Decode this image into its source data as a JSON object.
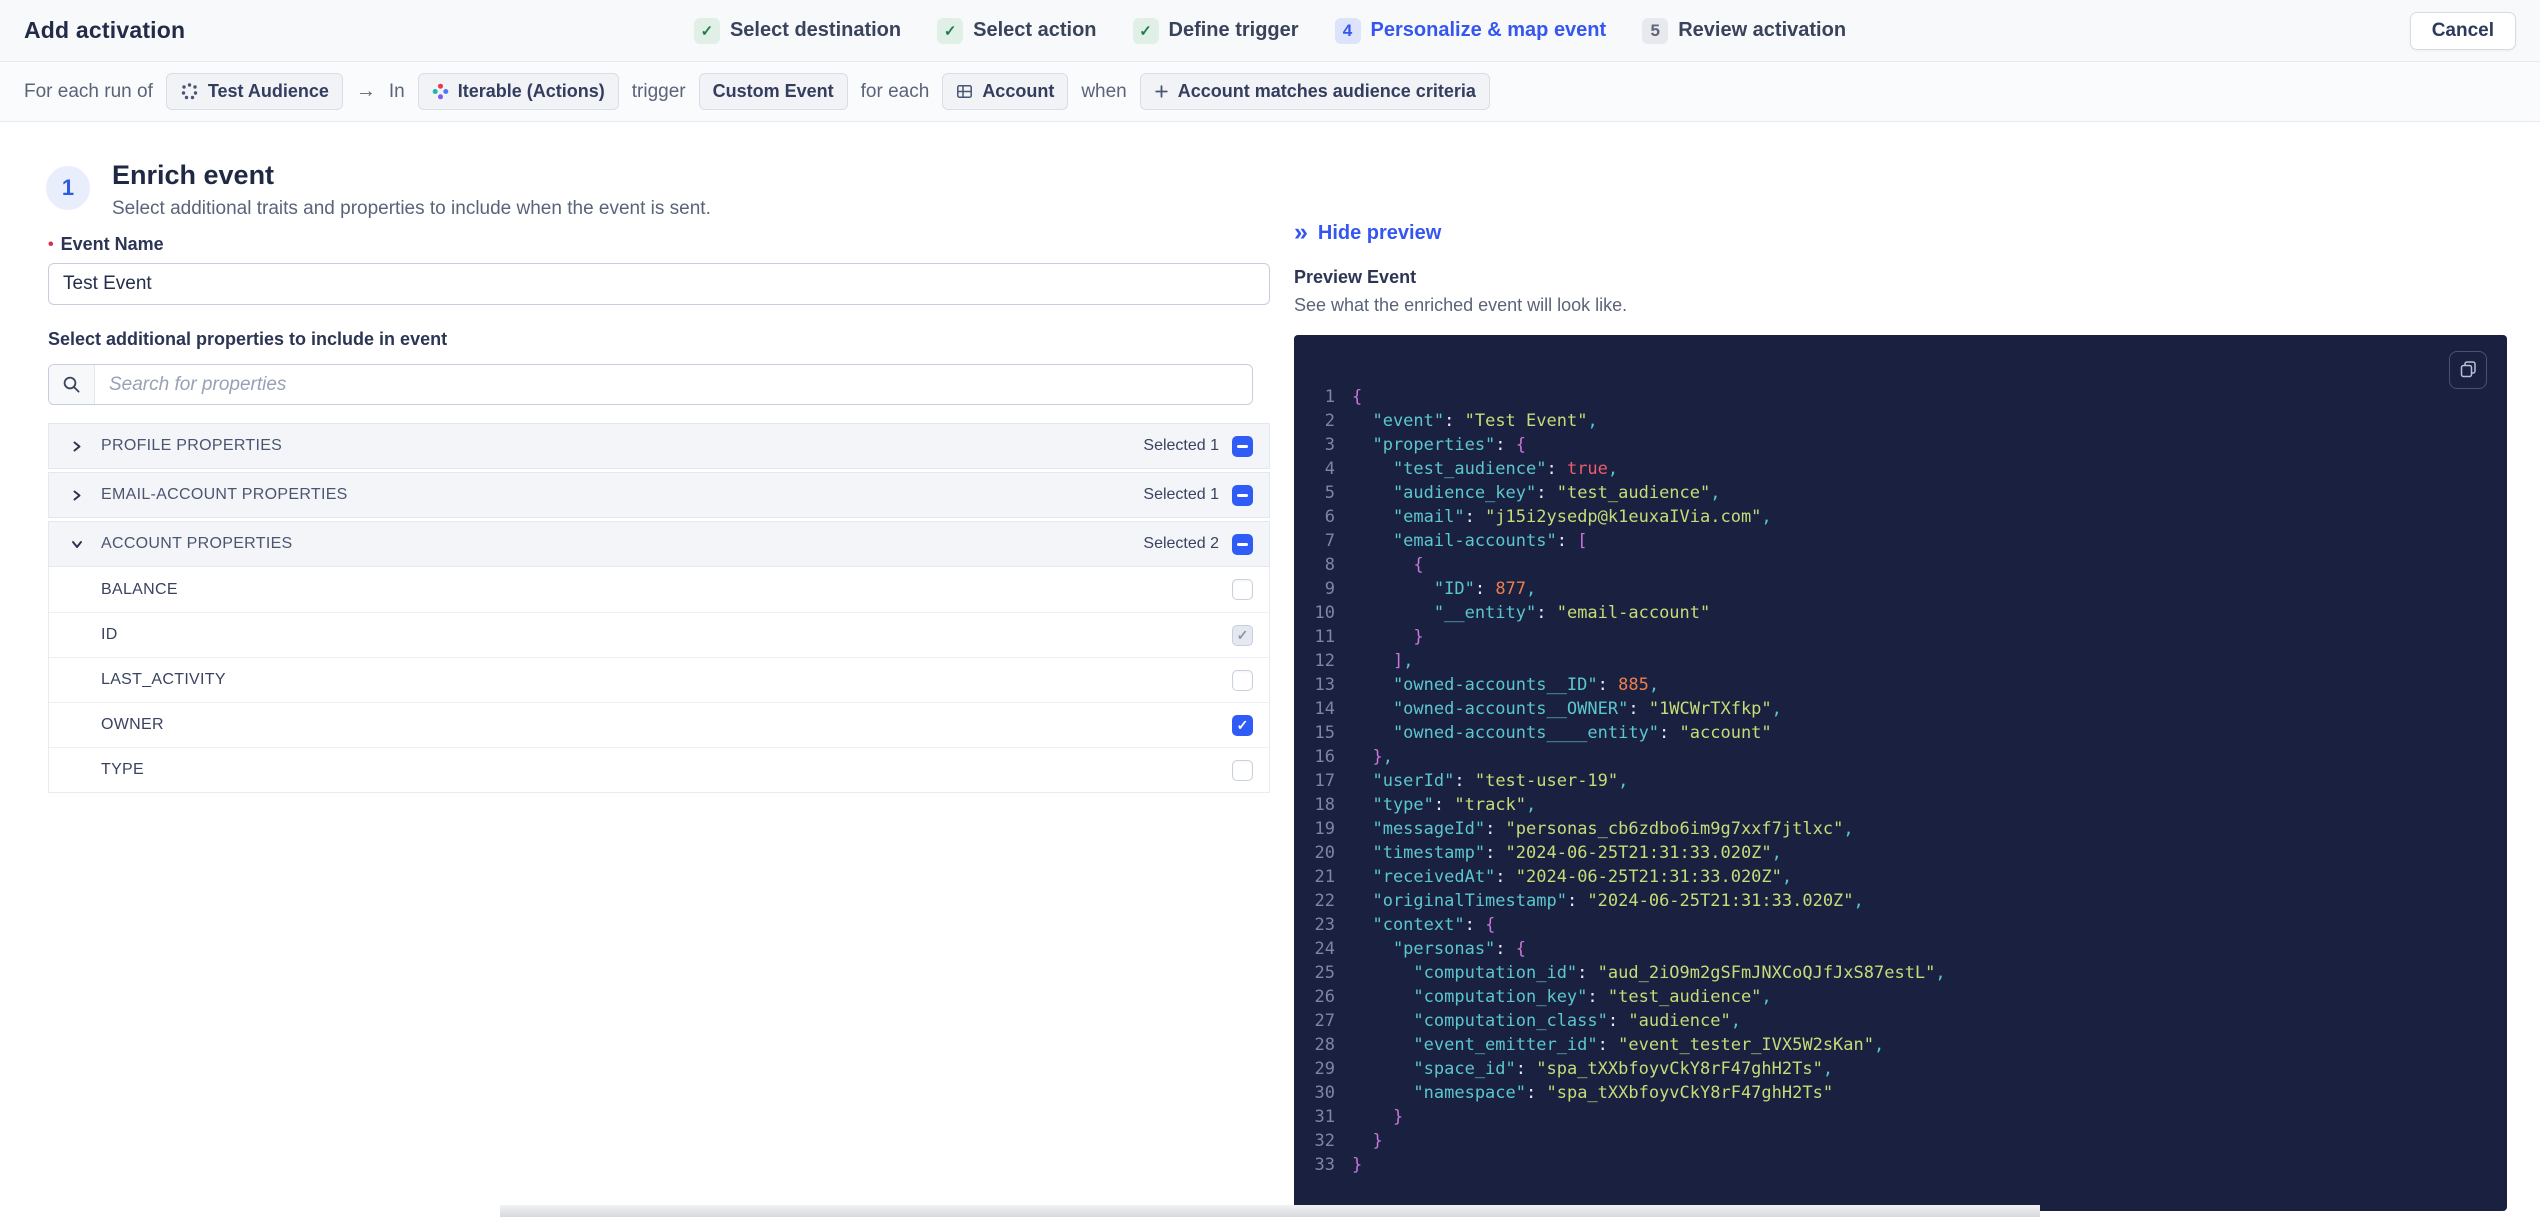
{
  "colors": {
    "accent": "#3556f0",
    "code_background": "#1a2040",
    "code_key": "#5bc7cc",
    "code_string": "#c6dc78",
    "code_number": "#ed7f4e",
    "code_boolean": "#ee5d6c",
    "code_brace": "#c877d8",
    "code_colon": "#e8ebf5",
    "checkbox_blue": "#2f5cf6",
    "step_done_green": "#1e7e47"
  },
  "header": {
    "title": "Add activation",
    "cancel_label": "Cancel",
    "steps": [
      {
        "label": "Select destination",
        "state": "done"
      },
      {
        "label": "Select action",
        "state": "done"
      },
      {
        "label": "Define trigger",
        "state": "done"
      },
      {
        "label": "Personalize & map event",
        "state": "active",
        "number": "4"
      },
      {
        "label": "Review activation",
        "state": "upcoming",
        "number": "5"
      }
    ]
  },
  "breadcrumb": {
    "segments": [
      {
        "type": "text",
        "text": "For each run of"
      },
      {
        "type": "chip",
        "text": "Test Audience",
        "icon": "audience-icon"
      },
      {
        "type": "arrow",
        "text": "→"
      },
      {
        "type": "text",
        "text": "In"
      },
      {
        "type": "chip",
        "text": "Iterable (Actions)",
        "icon": "iterable-icon"
      },
      {
        "type": "text",
        "text": "trigger"
      },
      {
        "type": "chip",
        "text": "Custom Event"
      },
      {
        "type": "text",
        "text": "for each"
      },
      {
        "type": "chip",
        "text": "Account",
        "icon": "grid-icon"
      },
      {
        "type": "text",
        "text": "when"
      },
      {
        "type": "chip",
        "text": "Account matches audience criteria",
        "icon": "plus-icon"
      }
    ]
  },
  "enrich": {
    "step_number": "1",
    "title": "Enrich event",
    "subtitle": "Select additional traits and properties to include when the event is sent.",
    "event_name_label": "Event Name",
    "event_name_value": "Test Event",
    "properties_label": "Select additional properties to include in event",
    "search_placeholder": "Search for properties",
    "groups": [
      {
        "label": "PROFILE PROPERTIES",
        "selected_text": "Selected 1",
        "expanded": false,
        "checkbox": "indeterminate",
        "children": []
      },
      {
        "label": "EMAIL-ACCOUNT PROPERTIES",
        "selected_text": "Selected 1",
        "expanded": false,
        "checkbox": "indeterminate",
        "children": []
      },
      {
        "label": "ACCOUNT PROPERTIES",
        "selected_text": "Selected 2",
        "expanded": true,
        "checkbox": "indeterminate",
        "children": [
          {
            "label": "BALANCE",
            "checkbox": "unchecked"
          },
          {
            "label": "ID",
            "checkbox": "checked-disabled"
          },
          {
            "label": "LAST_ACTIVITY",
            "checkbox": "unchecked"
          },
          {
            "label": "OWNER",
            "checkbox": "checked"
          },
          {
            "label": "TYPE",
            "checkbox": "unchecked"
          }
        ]
      }
    ]
  },
  "preview": {
    "hide_label": "Hide preview",
    "title": "Preview Event",
    "subtitle": "See what the enriched event will look like.",
    "code_lines": [
      [
        [
          "br",
          "{"
        ]
      ],
      [
        [
          "k",
          "  \"event\""
        ],
        [
          "c",
          ": "
        ],
        [
          "s",
          "\"Test Event\""
        ],
        [
          "k",
          ","
        ]
      ],
      [
        [
          "k",
          "  \"properties\""
        ],
        [
          "c",
          ": "
        ],
        [
          "br",
          "{"
        ]
      ],
      [
        [
          "k",
          "    \"test_audience\""
        ],
        [
          "c",
          ": "
        ],
        [
          "b",
          "true"
        ],
        [
          "k",
          ","
        ]
      ],
      [
        [
          "k",
          "    \"audience_key\""
        ],
        [
          "c",
          ": "
        ],
        [
          "s",
          "\"test_audience\""
        ],
        [
          "k",
          ","
        ]
      ],
      [
        [
          "k",
          "    \"email\""
        ],
        [
          "c",
          ": "
        ],
        [
          "s",
          "\"j15i2ysedp@k1euxaIVia.com\""
        ],
        [
          "k",
          ","
        ]
      ],
      [
        [
          "k",
          "    \"email-accounts\""
        ],
        [
          "c",
          ": "
        ],
        [
          "br",
          "["
        ]
      ],
      [
        [
          "br",
          "      {"
        ]
      ],
      [
        [
          "k",
          "        \"ID\""
        ],
        [
          "c",
          ": "
        ],
        [
          "n",
          "877"
        ],
        [
          "k",
          ","
        ]
      ],
      [
        [
          "k",
          "        \"__entity\""
        ],
        [
          "c",
          ": "
        ],
        [
          "s",
          "\"email-account\""
        ]
      ],
      [
        [
          "br",
          "      }"
        ]
      ],
      [
        [
          "br",
          "    ]"
        ],
        [
          "k",
          ","
        ]
      ],
      [
        [
          "k",
          "    \"owned-accounts__ID\""
        ],
        [
          "c",
          ": "
        ],
        [
          "n",
          "885"
        ],
        [
          "k",
          ","
        ]
      ],
      [
        [
          "k",
          "    \"owned-accounts__OWNER\""
        ],
        [
          "c",
          ": "
        ],
        [
          "s",
          "\"1WCWrTXfkp\""
        ],
        [
          "k",
          ","
        ]
      ],
      [
        [
          "k",
          "    \"owned-accounts____entity\""
        ],
        [
          "c",
          ": "
        ],
        [
          "s",
          "\"account\""
        ]
      ],
      [
        [
          "br",
          "  }"
        ],
        [
          "k",
          ","
        ]
      ],
      [
        [
          "k",
          "  \"userId\""
        ],
        [
          "c",
          ": "
        ],
        [
          "s",
          "\"test-user-19\""
        ],
        [
          "k",
          ","
        ]
      ],
      [
        [
          "k",
          "  \"type\""
        ],
        [
          "c",
          ": "
        ],
        [
          "s",
          "\"track\""
        ],
        [
          "k",
          ","
        ]
      ],
      [
        [
          "k",
          "  \"messageId\""
        ],
        [
          "c",
          ": "
        ],
        [
          "s",
          "\"personas_cb6zdbo6im9g7xxf7jtlxc\""
        ],
        [
          "k",
          ","
        ]
      ],
      [
        [
          "k",
          "  \"timestamp\""
        ],
        [
          "c",
          ": "
        ],
        [
          "s",
          "\"2024-06-25T21:31:33.020Z\""
        ],
        [
          "k",
          ","
        ]
      ],
      [
        [
          "k",
          "  \"receivedAt\""
        ],
        [
          "c",
          ": "
        ],
        [
          "s",
          "\"2024-06-25T21:31:33.020Z\""
        ],
        [
          "k",
          ","
        ]
      ],
      [
        [
          "k",
          "  \"originalTimestamp\""
        ],
        [
          "c",
          ": "
        ],
        [
          "s",
          "\"2024-06-25T21:31:33.020Z\""
        ],
        [
          "k",
          ","
        ]
      ],
      [
        [
          "k",
          "  \"context\""
        ],
        [
          "c",
          ": "
        ],
        [
          "br",
          "{"
        ]
      ],
      [
        [
          "k",
          "    \"personas\""
        ],
        [
          "c",
          ": "
        ],
        [
          "br",
          "{"
        ]
      ],
      [
        [
          "k",
          "      \"computation_id\""
        ],
        [
          "c",
          ": "
        ],
        [
          "s",
          "\"aud_2iO9m2gSFmJNXCoQJfJxS87estL\""
        ],
        [
          "k",
          ","
        ]
      ],
      [
        [
          "k",
          "      \"computation_key\""
        ],
        [
          "c",
          ": "
        ],
        [
          "s",
          "\"test_audience\""
        ],
        [
          "k",
          ","
        ]
      ],
      [
        [
          "k",
          "      \"computation_class\""
        ],
        [
          "c",
          ": "
        ],
        [
          "s",
          "\"audience\""
        ],
        [
          "k",
          ","
        ]
      ],
      [
        [
          "k",
          "      \"event_emitter_id\""
        ],
        [
          "c",
          ": "
        ],
        [
          "s",
          "\"event_tester_IVX5W2sKan\""
        ],
        [
          "k",
          ","
        ]
      ],
      [
        [
          "k",
          "      \"space_id\""
        ],
        [
          "c",
          ": "
        ],
        [
          "s",
          "\"spa_tXXbfoyvCkY8rF47ghH2Ts\""
        ],
        [
          "k",
          ","
        ]
      ],
      [
        [
          "k",
          "      \"namespace\""
        ],
        [
          "c",
          ": "
        ],
        [
          "s",
          "\"spa_tXXbfoyvCkY8rF47ghH2Ts\""
        ]
      ],
      [
        [
          "br",
          "    }"
        ]
      ],
      [
        [
          "br",
          "  }"
        ]
      ],
      [
        [
          "br",
          "}"
        ]
      ]
    ]
  }
}
